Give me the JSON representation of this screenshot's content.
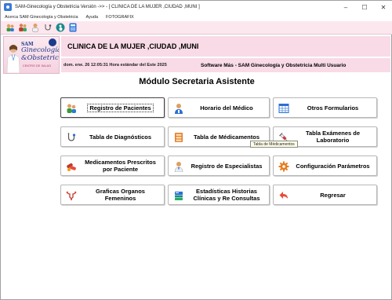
{
  "window": {
    "title": "SAM-Ginecología y Obstetricia Versión ->> - [ CLINICA DE LA MUJER ,CIUDAD ,MUNI ]",
    "controls": [
      "–",
      "☐",
      "✕"
    ]
  },
  "menu": [
    "Acerca SAM Ginecología y Obstetricia",
    "Ayuda",
    "FOTOGRAFIX"
  ],
  "toolbar": {
    "icons": [
      "people-icon",
      "users-icon",
      "doctor-icon",
      "stethoscope-icon",
      "pregnancy-icon",
      "calculator-icon"
    ]
  },
  "logo": {
    "sam": "SAM",
    "line1": "Ginecología",
    "line2": "&Obstetricia",
    "sub": "CENTRO DE SALUD"
  },
  "header": {
    "clinic_name": "CLINICA DE LA MUJER ,CIUDAD ,MUNI",
    "datetime": "dom. ene. 26 12:05:31 Hora estándar del Este 2025",
    "software": "Software Más - SAM Ginecología y Obstetricia Multi Usuario"
  },
  "module_title": "Módulo Secretaria Asistente",
  "buttons": {
    "registro_pacientes": "Registro de Pacientes",
    "horario_medico": "Horario del Médico",
    "otros_formularios": "Otros Formularios",
    "tabla_diagnosticos": "Tabla de Diagnósticos",
    "tabla_medicamentos": "Tabla de Médicamentos",
    "tabla_examenes_1": "Tabla Exámenes de",
    "tabla_examenes_2": "Laboratorio",
    "medicamentos_prescritos_1": "Medicamentos Prescritos",
    "medicamentos_prescritos_2": "por Paciente",
    "registro_especialistas": "Registro de Especialistas",
    "configuracion": "Configuración Parámetros",
    "graficas_1": "Graficas Organos",
    "graficas_2": "Femeninos",
    "estadisticas_1": "Estadísticas Historias",
    "estadisticas_2": "Clínicas y Re Consultas",
    "regresar": "Regresar"
  },
  "tooltip": "Tabla de Médicamentos",
  "colors": {
    "header_pink": "#f8dbe6",
    "toolbar_pink": "#fde7ef"
  }
}
